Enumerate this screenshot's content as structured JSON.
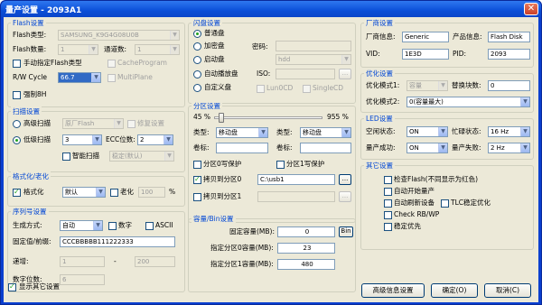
{
  "window": {
    "title": "量产设置 - 2093A1",
    "close": "✕"
  },
  "flash": {
    "title": "Flash设置",
    "type_label": "Flash类型:",
    "type_value": "SAMSUNG_K9G4G08U0B",
    "count_label": "Flash数量:",
    "count_value": "1",
    "channels_label": "通道数:",
    "channels_value": "1",
    "manual_label": "手动指定Flash类型",
    "cacheprogram_label": "CacheProgram",
    "rw_label": "R/W Cycle",
    "rw_value": "66.7",
    "multiplane_label": "MultiPlane",
    "force_label": "强制8H"
  },
  "scan": {
    "title": "扫描设置",
    "high_label": "高级扫描",
    "high_value": "原厂Flash",
    "repair_label": "修复设置",
    "low_label": "低级扫描",
    "low_value": "3",
    "ecc_label": "ECC位数:",
    "ecc_value": "2",
    "smart_label": "智能扫描",
    "stable_value": "稳定(默认)"
  },
  "format": {
    "title": "格式化/老化",
    "format_label": "格式化",
    "format_value": "默认",
    "aging_label": "老化",
    "aging_value": "100",
    "percent": "%"
  },
  "serial": {
    "title": "序列号设置",
    "mode_label": "生成方式:",
    "mode_value": "自动",
    "digit_label": "数字",
    "ascii_label": "ASCII",
    "prefix_label": "固定值/前缀:",
    "prefix_value": "CCCBBBBB111222333",
    "step_label": "递增:",
    "step_from": "1",
    "dash": "-",
    "step_to": "200",
    "digits_label": "数字位数:",
    "digits_value": "6"
  },
  "show_other": "显示其它设置",
  "disk": {
    "title": "闪盘设置",
    "normal_label": "普通盘",
    "encrypt_label": "加密盘",
    "password_label": "密码:",
    "boot_label": "启动盘",
    "boot_value": "hdd",
    "autoplay_label": "自动播放盘",
    "iso_label": "ISO:",
    "custom_label": "自定义盘",
    "lun0cd": "Lun0CD",
    "singlecd": "SingleCD"
  },
  "partition": {
    "title": "分区设置",
    "min_percent": "45 %",
    "max_percent": "955 %",
    "type_label": "类型:",
    "type1": "移动盘",
    "type2": "移动盘",
    "volume_label": "卷标:",
    "volume_label2": "卷标:",
    "p0_protect": "分区0写保护",
    "p1_protect": "分区1写保护",
    "copy0_label": "拷贝到分区0",
    "copy0_value": "C:\\usb1",
    "copy1_label": "拷贝到分区1",
    "dots": "..."
  },
  "capacity": {
    "title": "容量/Bin设置",
    "fixed_label": "固定容量(MB):",
    "fixed_value": "0",
    "bin_button": "Bin",
    "p0_label": "指定分区0容量(MB):",
    "p0_value": "23",
    "p1_label": "指定分区1容量(MB):",
    "p1_value": "480"
  },
  "vendor": {
    "title": "厂商设置",
    "vendor_label": "厂商信息:",
    "vendor_value": "Generic",
    "product_label": "产品信息:",
    "product_value": "Flash Disk",
    "vid_label": "VID:",
    "vid_value": "1E3D",
    "pid_label": "PID:",
    "pid_value": "2093"
  },
  "optimize": {
    "title": "优化设置",
    "mode1_label": "优化模式1:",
    "mode1_value": "容量",
    "swap_label": "替换块数:",
    "swap_value": "0",
    "mode2_label": "优化模式2:",
    "mode2_value": "0(容量最大)"
  },
  "led": {
    "title": "LED设置",
    "idle_label": "空闲状态:",
    "idle_value": "ON",
    "busy_label": "忙碌状态:",
    "busy_value": "16 Hz",
    "success_label": "量产成功:",
    "success_value": "ON",
    "fail_label": "量产失败:",
    "fail_value": "2 Hz"
  },
  "other": {
    "title": "其它设置",
    "check_flash": "检查Flash(不同显示为红色)",
    "auto_start": "自动开始量产",
    "auto_refresh": "自动刷新设备",
    "tlc": "TLC稳定优化",
    "check_rbwp": "Check RB/WP",
    "stable_first": "稳定优先"
  },
  "buttons": {
    "advanced": "高级信息设置",
    "ok": "确定(O)",
    "cancel": "取消(C)"
  }
}
